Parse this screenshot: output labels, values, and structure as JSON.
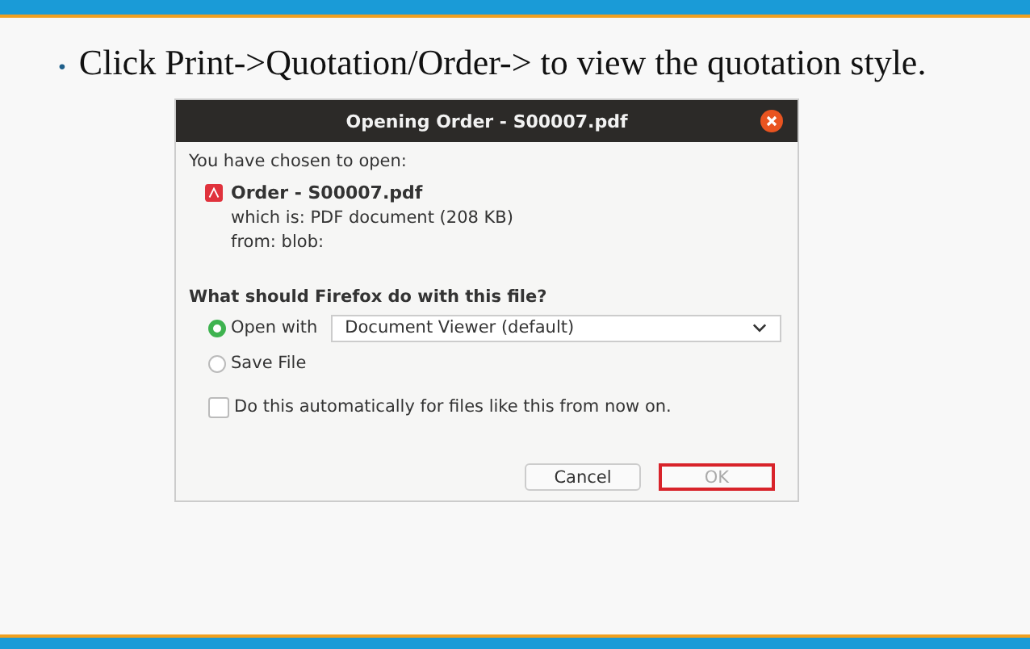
{
  "slide": {
    "bullet": "•",
    "text": "Click Print->Quotation/Order-> to view the quotation style."
  },
  "dialog": {
    "title": "Opening Order - S00007.pdf",
    "intro": "You have chosen to open:",
    "file_name": "Order - S00007.pdf",
    "which_is": "which is:  PDF document (208 KB)",
    "from": "from:  blob:",
    "question": "What should Firefox do with this file?",
    "options": [
      {
        "label": "Open with",
        "selected": true,
        "app": "Document Viewer (default)"
      },
      {
        "label": "Save File",
        "selected": false
      }
    ],
    "auto": {
      "label": "Do this automatically for files like this from now on.",
      "checked": false
    },
    "buttons": [
      {
        "label": "Cancel",
        "disabled": false,
        "highlighted": false
      },
      {
        "label": "OK",
        "disabled": true,
        "highlighted": true
      }
    ]
  }
}
